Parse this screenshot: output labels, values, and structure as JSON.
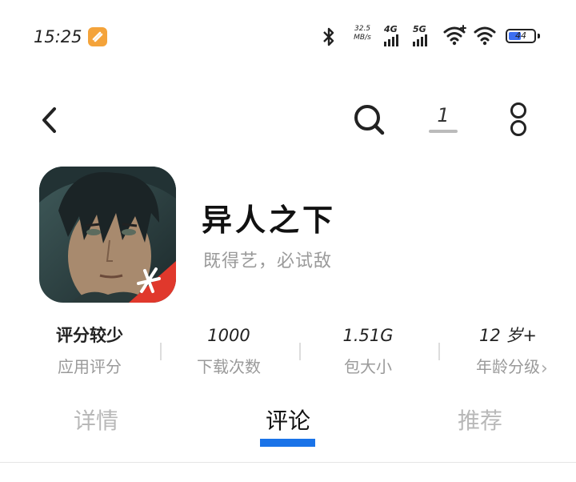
{
  "status_bar": {
    "time": "15:25",
    "net_speed_value": "32.5",
    "net_speed_unit": "MB/s",
    "signal_1_label": "4G",
    "signal_2_label": "5G",
    "battery": "44"
  },
  "nav": {
    "download_count": "1"
  },
  "app": {
    "title": "异人之下",
    "slogan": "既得艺，必试敌"
  },
  "stats": [
    {
      "value": "评分较少",
      "label": "应用评分"
    },
    {
      "value": "1000",
      "label": "下载次数"
    },
    {
      "value": "1.51G",
      "label": "包大小"
    },
    {
      "value": "12 岁+",
      "label": "年龄分级"
    }
  ],
  "tabs": [
    {
      "label": "详情"
    },
    {
      "label": "评论"
    },
    {
      "label": "推荐"
    }
  ],
  "active_tab": "评论",
  "colors": {
    "accent": "#1a73e8",
    "app_badge": "#f4a33a",
    "battery_fill": "#3d6ff0"
  }
}
